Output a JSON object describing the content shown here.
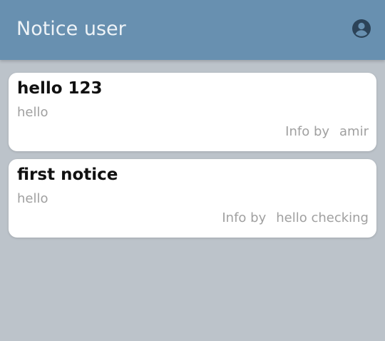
{
  "app_bar": {
    "title": "Notice user",
    "account_icon": "account-circle-icon",
    "color": "#6890b0"
  },
  "notices": [
    {
      "title": "hello 123",
      "body": "hello",
      "info_label": "Info by",
      "author": "amir"
    },
    {
      "title": "first notice",
      "body": "hello",
      "info_label": "Info by",
      "author": "hello checking"
    }
  ],
  "background_color": "#bcc3ca"
}
